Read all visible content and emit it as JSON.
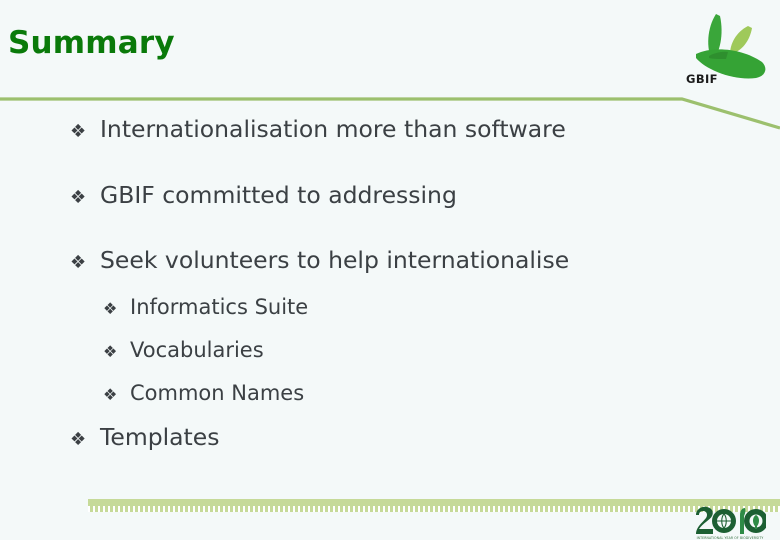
{
  "slide": {
    "title": "Summary",
    "background_color": "#f4f9f9",
    "title_color": "#0a7a0a",
    "rule_color": "#9cc06e",
    "body_text_color": "#3b4044",
    "footer_band_color": "#c6da99"
  },
  "bullets": [
    {
      "level": 1,
      "marker": "❖",
      "text": "Internationalisation more than software"
    },
    {
      "level": 1,
      "marker": "❖",
      "text": "GBIF committed to addressing"
    },
    {
      "level": 1,
      "marker": "❖",
      "text": "Seek volunteers to help internationalise"
    },
    {
      "level": 2,
      "marker": "❖",
      "text": "Informatics Suite"
    },
    {
      "level": 2,
      "marker": "❖",
      "text": "Vocabularies"
    },
    {
      "level": 2,
      "marker": "❖",
      "text": "Common Names"
    },
    {
      "level": 1,
      "marker": "❖",
      "text": "Templates"
    }
  ],
  "gbif_logo": {
    "wordmark": "GBIF",
    "leaf_dark": "#3aa63a",
    "leaf_mid": "#35a335",
    "leaf_light": "#9fc95a",
    "icon_name": "gbif-sprout-logo"
  },
  "biodiversity_logo": {
    "year": "2010",
    "caption": "INTERNATIONAL YEAR OF BIODIVERSITY",
    "color_dark": "#1c5f33",
    "color_mid": "#2e8b46",
    "icon_name": "biodiversity-2010-logo"
  }
}
